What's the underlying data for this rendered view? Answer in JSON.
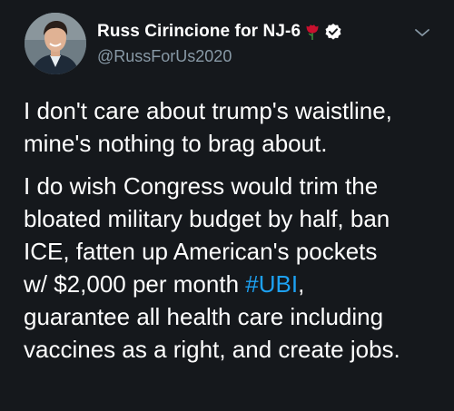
{
  "author": {
    "display_name": "Russ Cirincione for NJ-6",
    "handle": "@RussForUs2020",
    "badges": [
      "rose-icon",
      "verified-icon"
    ],
    "avatar": "avatar-photo"
  },
  "menu": {
    "icon": "chevron-down-icon"
  },
  "tweet": {
    "paragraph1": {
      "line1": "I don't care about trump's waistline,",
      "line2": "mine's nothing to brag about."
    },
    "paragraph2": {
      "line1": "I do wish Congress would trim the",
      "line2": "bloated military budget by half, ban",
      "line3": "ICE, fatten up American's pockets",
      "line4_before": "w/ $2,000 per month ",
      "hashtag": "#UBI",
      "line4_after": ",",
      "line5": "guarantee all health care including",
      "line6": "vaccines as a right, and create jobs."
    }
  },
  "colors": {
    "background": "#15181c",
    "text": "#ffffff",
    "secondary_text": "#8899a6",
    "hashtag": "#1da1f2",
    "rose": "#c8102e",
    "verified_badge": "#ffffff"
  }
}
